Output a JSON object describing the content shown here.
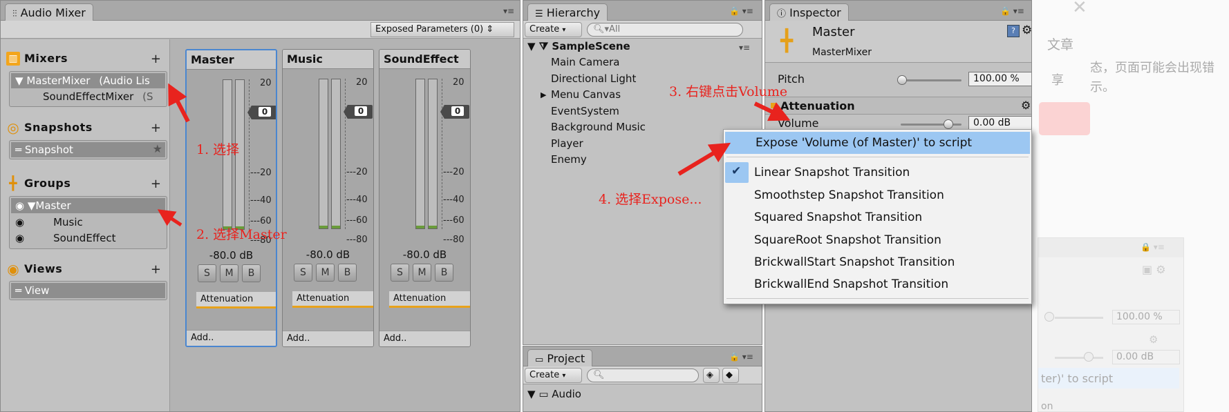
{
  "audio_mixer": {
    "tab_label": "Audio Mixer",
    "tab_icon": "mixer-sliders-icon",
    "exposed_params": "Exposed Parameters (0)",
    "mixers": {
      "title": "Mixers",
      "items": [
        "MasterMixer",
        "SoundEffectMixer"
      ],
      "item_suffix_0": "(Audio Lis",
      "item_suffix_1": "(S"
    },
    "snapshots": {
      "title": "Snapshots",
      "items": [
        "Snapshot"
      ]
    },
    "groups": {
      "title": "Groups",
      "items": [
        "Master",
        "Music",
        "SoundEffect"
      ]
    },
    "views": {
      "title": "Views",
      "items": [
        "View"
      ]
    },
    "add": "+",
    "strips": [
      {
        "name": "Master",
        "db": "-80.0 dB",
        "level": "0",
        "effect": "Attenuation",
        "add": "Add.."
      },
      {
        "name": "Music",
        "db": "-80.0 dB",
        "level": "0",
        "effect": "Attenuation",
        "add": "Add.."
      },
      {
        "name": "SoundEffect",
        "db": "-80.0 dB",
        "level": "0",
        "effect": "Attenuation",
        "add": "Add.."
      }
    ],
    "ticks": [
      "20",
      "-20",
      "-40",
      "-60",
      "-80"
    ],
    "smb": [
      "S",
      "M",
      "B"
    ]
  },
  "hierarchy": {
    "tab_label": "Hierarchy",
    "create": "Create",
    "search_placeholder": "All",
    "scene": "SampleScene",
    "items": [
      "Main Camera",
      "Directional Light",
      "Menu Canvas",
      "EventSystem",
      "Background Music",
      "Player",
      "Enemy"
    ]
  },
  "project": {
    "tab_label": "Project",
    "create": "Create",
    "folder": "Audio"
  },
  "inspector": {
    "tab_label": "Inspector",
    "name": "Master",
    "subname": "MasterMixer",
    "pitch_label": "Pitch",
    "pitch_value": "100.00 %",
    "attenuation": "Attenuation",
    "volume_label": "Volume",
    "volume_value": "0.00 dB"
  },
  "context_menu": {
    "items": [
      "Expose 'Volume (of Master)' to script",
      "Linear Snapshot Transition",
      "Smoothstep Snapshot Transition",
      "Squared Snapshot Transition",
      "SquareRoot Snapshot Transition",
      "BrickwallStart Snapshot Transition",
      "BrickwallEnd Snapshot Transition"
    ],
    "checked": "✔"
  },
  "annotations": [
    "1. 选择",
    "2. 选择Master",
    "3. 右键点击Volume",
    "4. 选择Expose..."
  ],
  "background": {
    "t1": "文章",
    "t2": "态，页面可能会出现错",
    "t3": "享",
    "t4": "示。",
    "pct": "100.00 %",
    "db": "0.00 dB",
    "script": "ter)' to script",
    "on": "on"
  },
  "colors": {
    "accent": "#4a86d0",
    "annotation": "#e8231e",
    "menu_highlight": "#9cc7f2",
    "effect_bar": "#e8a21a"
  }
}
